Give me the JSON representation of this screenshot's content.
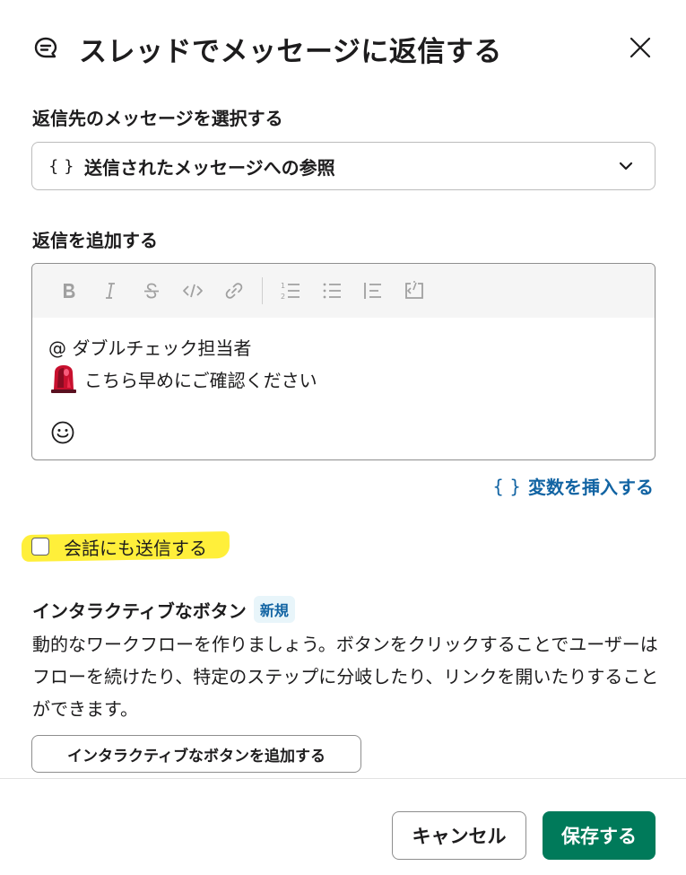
{
  "dialog": {
    "title": "スレッドでメッセージに返信する",
    "title_icon": "thread-reply-icon",
    "close_icon": "close-icon"
  },
  "target_message": {
    "label": "返信先のメッセージを選択する",
    "braces": "{ }",
    "selected_value": "送信されたメッセージへの参照"
  },
  "reply": {
    "label": "返信を追加する",
    "toolbar": [
      "bold-icon",
      "italic-icon",
      "strikethrough-icon",
      "code-icon",
      "link-icon",
      "ordered-list-icon",
      "bullet-list-icon",
      "blockquote-icon",
      "code-block-icon"
    ],
    "lines": [
      "@ ダブルチェック担当者",
      "こちら早めにご確認ください"
    ],
    "emoji_icon": "emoji-icon",
    "siren_icon": "rotating-light-icon"
  },
  "insert_variable": {
    "braces": "{ }",
    "label": "変数を挿入する"
  },
  "send_to_channel": {
    "label": "会話にも送信する",
    "checked": false,
    "highlight_color": "#ffef3a"
  },
  "interactive": {
    "title": "インタラクティブなボタン",
    "badge": "新規",
    "description": "動的なワークフローを作りましょう。ボタンをクリックすることでユーザーはフローを続けたり、特定のステップに分岐したり、リンクを開いたりすることができます。",
    "add_button": "インタラクティブなボタンを追加する"
  },
  "footer": {
    "cancel": "キャンセル",
    "save": "保存する"
  },
  "colors": {
    "primary": "#007a5a",
    "link": "#1264a3"
  }
}
